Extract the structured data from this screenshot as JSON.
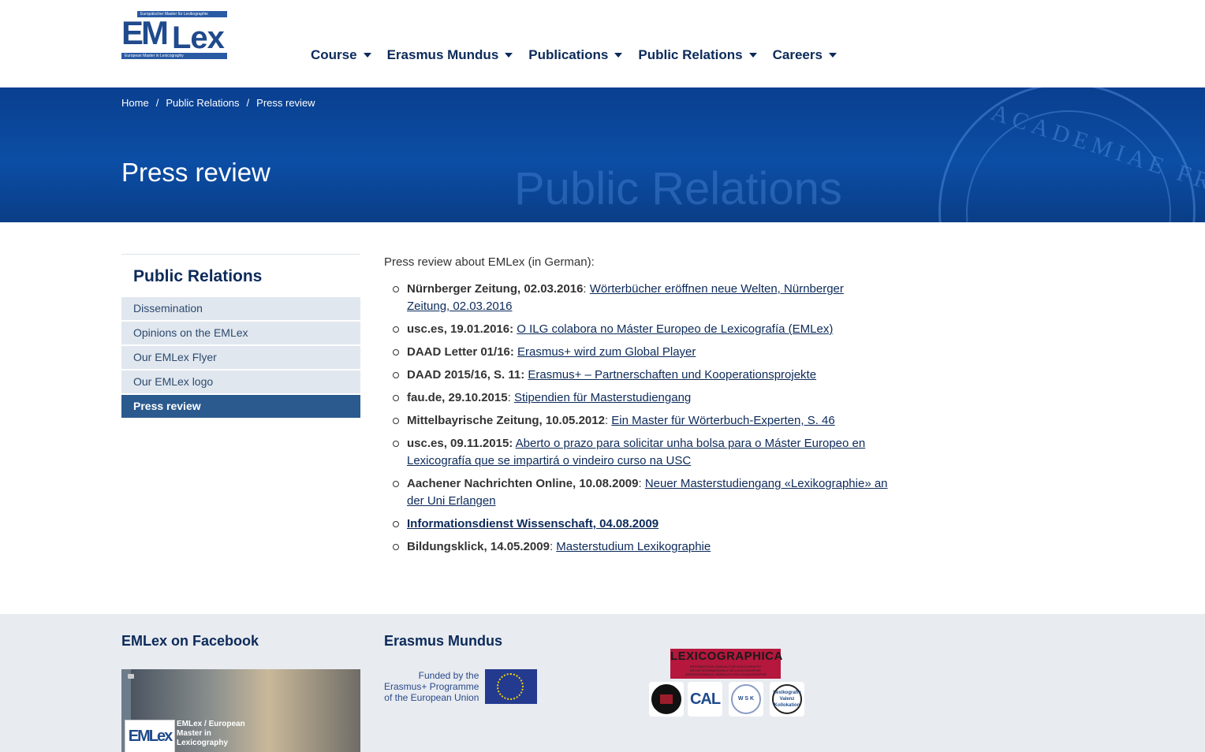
{
  "logo": {
    "top_strip": "Europäischer Master für Lexikographie",
    "em": "EM",
    "lex": "Lex",
    "bottom_strip": "European Master in Lexicography"
  },
  "nav": {
    "items": [
      {
        "label": "Course"
      },
      {
        "label": "Erasmus Mundus"
      },
      {
        "label": "Publications"
      },
      {
        "label": "Public Relations"
      },
      {
        "label": "Careers"
      }
    ]
  },
  "breadcrumb": {
    "items": [
      "Home",
      "Public Relations",
      "Press review"
    ],
    "separator": "/"
  },
  "banner": {
    "title": "Press review",
    "watermark": "Public Relations",
    "seal_text": "ACADEMIAE FRIDERICO ALE"
  },
  "sidebar": {
    "heading": "Public Relations",
    "items": [
      {
        "label": "Dissemination"
      },
      {
        "label": "Opinions on the EMLex"
      },
      {
        "label": "Our EMLex Flyer"
      },
      {
        "label": "Our EMLex logo"
      },
      {
        "label": "Press review"
      }
    ],
    "active_index": 4
  },
  "content": {
    "intro": "Press review about EMLex (in German):",
    "items": [
      {
        "source": "Nürnberger Zeitung, 02.03.2016",
        "sep": ": ",
        "link": "Wörterbücher eröffnen neue Welten, Nürnberger Zeitung, 02.03.2016"
      },
      {
        "source": "usc.es, 19.01.2016:",
        "sep": " ",
        "link": "O ILG colabora no Máster Europeo de Lexicografía (EMLex)"
      },
      {
        "source": "DAAD Letter 01/16:",
        "sep": " ",
        "link": "Erasmus+ wird zum Global Player"
      },
      {
        "source": "DAAD 2015/16, S. 11:",
        "sep": " ",
        "link": "Erasmus+ – Partnerschaften und Kooperationsprojekte"
      },
      {
        "source": "fau.de, 29.10.2015",
        "sep": ": ",
        "link": "Stipendien für Masterstudiengang"
      },
      {
        "source": "Mittelbayrische Zeitung, 10.05.2012",
        "sep": ": ",
        "link": "Ein Master für Wörterbuch-Experten, S. 46"
      },
      {
        "source": "usc.es, 09.11.2015:",
        "sep": " ",
        "link": "Aberto o prazo para solicitar unha bolsa para o Máster Europeo en Lexicografía que se impartirá o vindeiro curso na USC"
      },
      {
        "source": "Aachener Nachrichten Online, 10.08.2009",
        "sep": ": ",
        "link": "Neuer Masterstudiengang «Lexikographie» an der Uni Erlangen"
      },
      {
        "source": "",
        "sep": "",
        "link": "Informationsdienst Wissenschaft, 04.08.2009"
      },
      {
        "source": "Bildungsklick, 14.05.2009",
        "sep": ": ",
        "link": "Masterstudium Lexikographie"
      }
    ]
  },
  "footer": {
    "facebook_heading": "EMLex on Facebook",
    "facebook_logo": "EMLex",
    "facebook_caption": "EMLex / European Master in Lexicography",
    "erasmus_heading": "Erasmus Mundus",
    "eu_text_1": "Funded by the",
    "eu_text_2": "Erasmus+ Programme",
    "eu_text_3": "of the European Union",
    "lexicographica_title": "LEXICOGRAPHICA",
    "lexicographica_sub1": "INTERNATIONAL ANNUAL FOR LEXICOGRAPHY",
    "lexicographica_sub2": "REVUE INTERNATIONALE DE LEXICOGRAPHIE",
    "lexicographica_sub3": "INTERNATIONALES JAHRBUCH FÜR LEXIKOGRAPHIE",
    "partner_cal": "CAL",
    "partner_wsk": "W S K",
    "partner_lk": "Lexikografie Valenz Kollokation"
  },
  "colors": {
    "primary": "#0c2a5a",
    "banner": "#0b4ea5",
    "sidebar_active": "#2b5a8e",
    "sidebar_item": "#e1e7ef",
    "footer": "#e8ebf0"
  }
}
